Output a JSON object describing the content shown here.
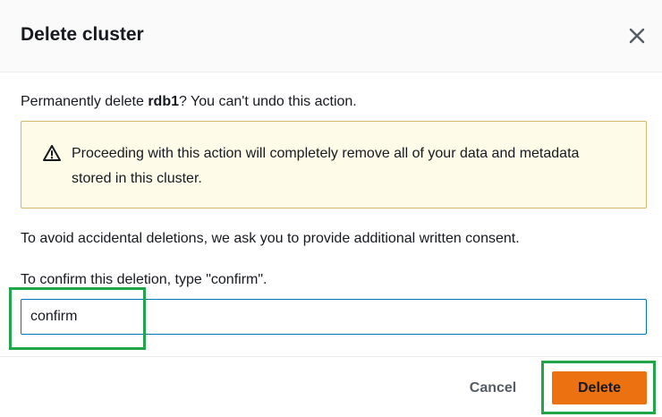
{
  "dialog": {
    "title": "Delete cluster",
    "close_icon": "close-icon"
  },
  "intro": {
    "prefix": "Permanently delete ",
    "cluster_name": "rdb1",
    "suffix": "? You can't undo this action."
  },
  "warning": {
    "icon": "warning-triangle-icon",
    "text": "Proceeding with this action will completely remove all of your data and metadata stored in this cluster."
  },
  "consent_text": "To avoid accidental deletions, we ask you to provide additional written consent.",
  "confirm": {
    "label": "To confirm this deletion, type \"confirm\".",
    "value": "confirm"
  },
  "footer": {
    "cancel_label": "Cancel",
    "delete_label": "Delete"
  },
  "colors": {
    "primary_button": "#ec7211",
    "input_focus_border": "#0073bb",
    "warning_background": "#fefbe9",
    "highlight_box": "#1fa64a"
  }
}
